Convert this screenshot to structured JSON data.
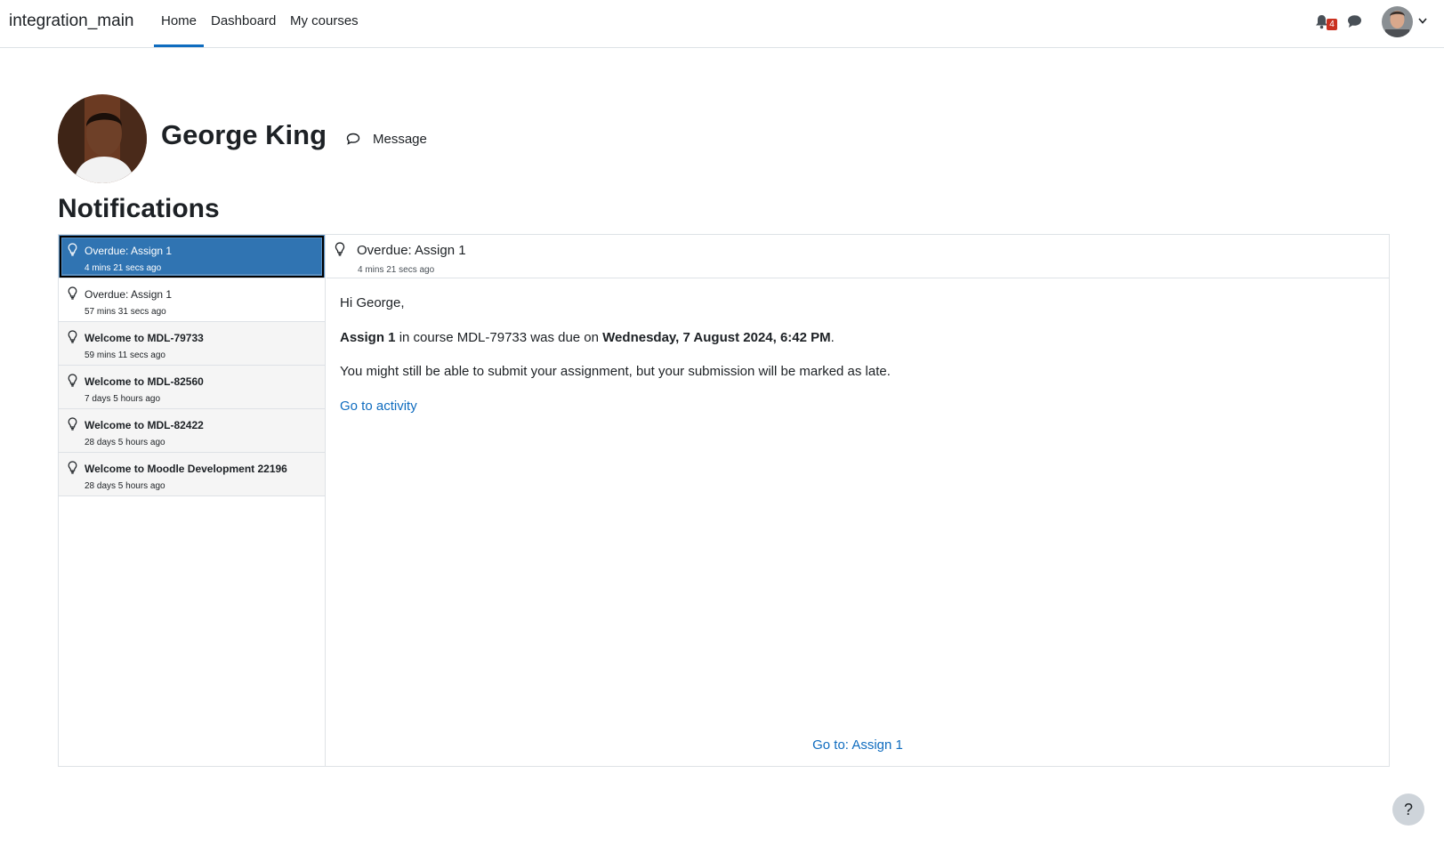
{
  "navbar": {
    "site_name": "integration_main",
    "links": [
      "Home",
      "Dashboard",
      "My courses"
    ],
    "active_link": "Home",
    "notification_count": "4",
    "accent_color": "#0f6cbf",
    "badge_color": "#ca3120"
  },
  "profile": {
    "name": "George King",
    "message_label": "Message"
  },
  "page": {
    "heading": "Notifications"
  },
  "notifications": [
    {
      "title": "Overdue: Assign 1",
      "time": "4 mins 21 secs ago",
      "state": "selected"
    },
    {
      "title": "Overdue: Assign 1",
      "time": "57 mins 31 secs ago",
      "state": "read"
    },
    {
      "title": "Welcome to MDL-79733",
      "time": "59 mins 11 secs ago",
      "state": "unread"
    },
    {
      "title": "Welcome to MDL-82560",
      "time": "7 days 5 hours ago",
      "state": "unread"
    },
    {
      "title": "Welcome to MDL-82422",
      "time": "28 days 5 hours ago",
      "state": "unread"
    },
    {
      "title": "Welcome to Moodle Development 22196",
      "time": "28 days 5 hours ago",
      "state": "unread"
    }
  ],
  "detail": {
    "title": "Overdue: Assign 1",
    "time": "4 mins 21 secs ago",
    "greeting": "Hi George,",
    "due": {
      "assignment": "Assign 1",
      "middle": " in course MDL-79733 was due on ",
      "date": "Wednesday, 7 August 2024, 6:42 PM",
      "end": "."
    },
    "late_message": "You might still be able to submit your assignment, but your submission will be marked as late.",
    "activity_link": "Go to activity",
    "footer_link": "Go to: Assign 1"
  },
  "help": {
    "label": "?"
  }
}
